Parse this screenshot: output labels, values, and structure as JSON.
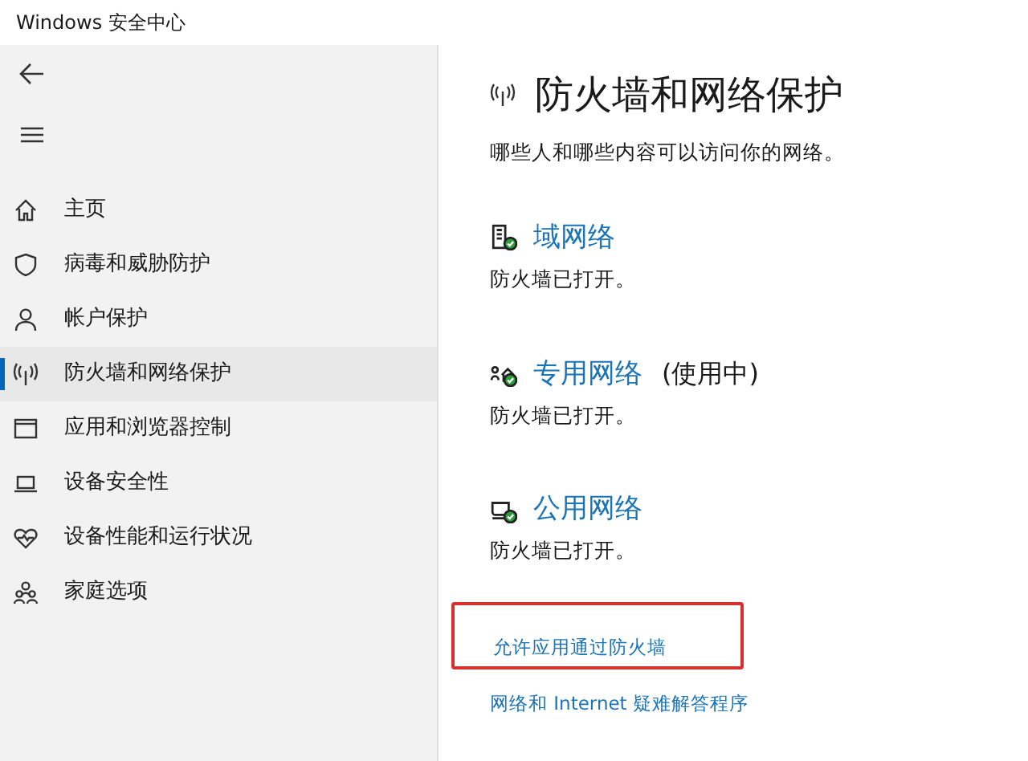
{
  "window": {
    "title": "Windows 安全中心"
  },
  "sidebar": {
    "items": [
      {
        "label": "主页",
        "kind": "home",
        "selected": false
      },
      {
        "label": "病毒和威胁防护",
        "kind": "shield",
        "selected": false
      },
      {
        "label": "帐户保护",
        "kind": "person",
        "selected": false
      },
      {
        "label": "防火墙和网络保护",
        "kind": "antenna",
        "selected": true
      },
      {
        "label": "应用和浏览器控制",
        "kind": "window",
        "selected": false
      },
      {
        "label": "设备安全性",
        "kind": "laptop",
        "selected": false
      },
      {
        "label": "设备性能和运行状况",
        "kind": "heart",
        "selected": false
      },
      {
        "label": "家庭选项",
        "kind": "family",
        "selected": false
      }
    ]
  },
  "page": {
    "title": "防火墙和网络保护",
    "subtitle": "哪些人和哪些内容可以访问你的网络。"
  },
  "networks": [
    {
      "kind": "domain",
      "name": "域网络",
      "status": "防火墙已打开。"
    },
    {
      "kind": "private",
      "name": "专用网络",
      "note": "(使用中)",
      "status": "防火墙已打开。"
    },
    {
      "kind": "public",
      "name": "公用网络",
      "status": "防火墙已打开。"
    }
  ],
  "links": [
    {
      "label": "允许应用通过防火墙",
      "highlighted": true
    },
    {
      "label": "网络和 Internet 疑难解答程序",
      "highlighted": false
    }
  ]
}
